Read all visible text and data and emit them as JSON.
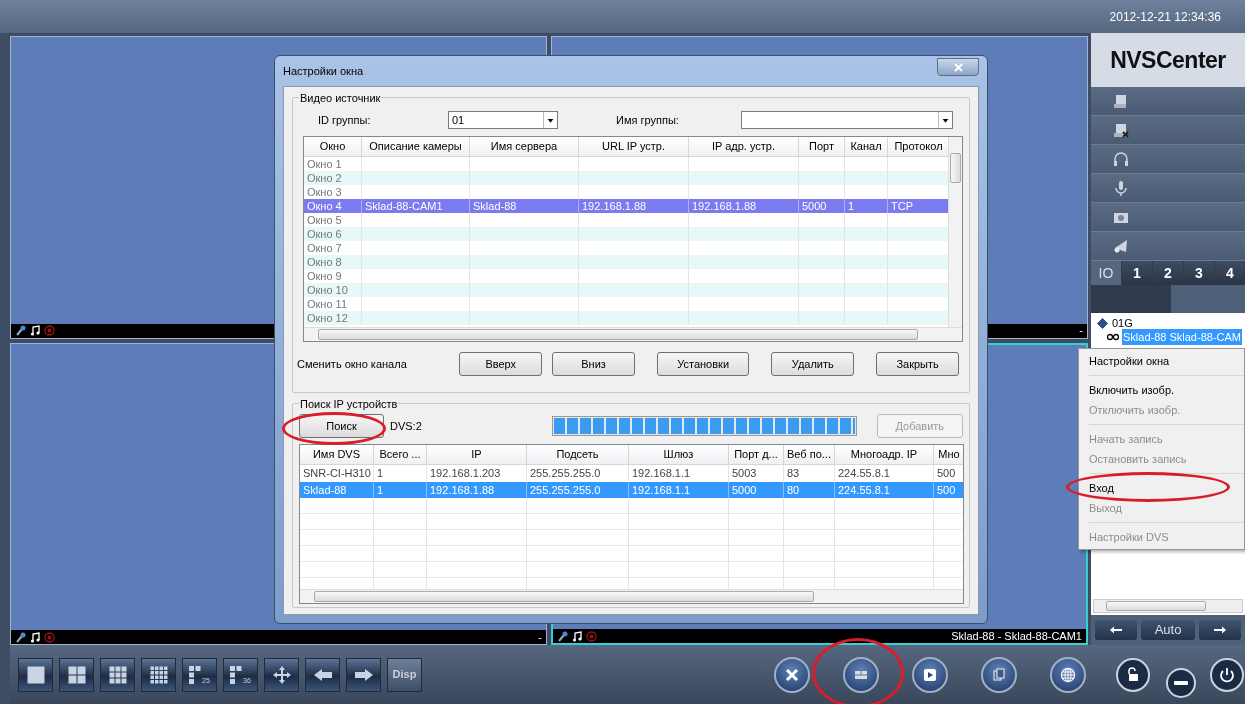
{
  "clock": "2012-12-21 12:34:36",
  "video_panes": [
    {
      "selected": false,
      "status_icons": true
    },
    {
      "selected": false,
      "dash": "-"
    },
    {
      "selected": false,
      "status_icons": true,
      "dash": "-"
    },
    {
      "selected": true,
      "status_icons": true,
      "caption": "Sklad-88 - Sklad-88-CAM1"
    }
  ],
  "dialog": {
    "title": "Настройки окна",
    "video_source": {
      "legend": "Видео источник",
      "group_id_label": "ID группы:",
      "group_id_value": "01",
      "group_name_label": "Имя группы:",
      "columns": [
        "Окно",
        "Описание камеры",
        "Имя сервера",
        "URL IP устр.",
        "IP адр. устр.",
        "Порт",
        "Канал",
        "Протокол"
      ],
      "rows": [
        {
          "cells": [
            "Окно 1"
          ],
          "selected": false
        },
        {
          "cells": [
            "Окно 2"
          ],
          "selected": false
        },
        {
          "cells": [
            "Окно 3"
          ],
          "selected": false
        },
        {
          "cells": [
            "Окно 4",
            "Sklad-88-CAM1",
            "Sklad-88",
            "192.168.1.88",
            "192.168.1.88",
            "5000",
            "1",
            "TCP"
          ],
          "selected": true
        },
        {
          "cells": [
            "Окно 5"
          ],
          "selected": false
        },
        {
          "cells": [
            "Окно 6"
          ],
          "selected": false
        },
        {
          "cells": [
            "Окно 7"
          ],
          "selected": false
        },
        {
          "cells": [
            "Окно 8"
          ],
          "selected": false
        },
        {
          "cells": [
            "Окно 9"
          ],
          "selected": false
        },
        {
          "cells": [
            "Окно 10"
          ],
          "selected": false
        },
        {
          "cells": [
            "Окно 11"
          ],
          "selected": false
        },
        {
          "cells": [
            "Окно 12"
          ],
          "selected": false
        }
      ],
      "change_label": "Сменить окно канала",
      "buttons": [
        "Вверх",
        "Вниз",
        "Установки",
        "Удалить",
        "Закрыть"
      ]
    },
    "ip_search": {
      "legend": "Поиск IP устройств",
      "search_button": "Поиск",
      "count": "DVS:2",
      "progress": {
        "level": 1
      },
      "add_button": {
        "label": "Добавить",
        "disabled": true
      },
      "columns": [
        "Имя DVS",
        "Всего ...",
        "IP",
        "Подсеть",
        "Шлюз",
        "Порт д...",
        "Веб по...",
        "Многоадр. IP",
        "Мно"
      ],
      "rows": [
        {
          "cells": [
            "SNR-CI-H310",
            "1",
            "192.168.1.203",
            "255.255.255.0",
            "192.168.1.1",
            "5003",
            "83",
            "224.55.8.1",
            "500"
          ],
          "selected": false
        },
        {
          "cells": [
            "Sklad-88",
            "1",
            "192.168.1.88",
            "255.255.255.0",
            "192.168.1.1",
            "5000",
            "80",
            "224.55.8.1",
            "500"
          ],
          "selected": true
        }
      ]
    }
  },
  "sidebar": {
    "logo": "NVSCenter",
    "tabs": [
      {
        "label": "IO",
        "selected": true
      },
      {
        "label": "1",
        "selected": false
      },
      {
        "label": "2",
        "selected": false
      },
      {
        "label": "3",
        "selected": false
      },
      {
        "label": "4",
        "selected": false
      }
    ],
    "tree": [
      {
        "label": "01G",
        "expanded": true,
        "children": [
          {
            "label": "Sklad-88 Sklad-88-CAM",
            "selected": true
          }
        ]
      }
    ],
    "nav_buttons": [
      {
        "kind": "prev"
      },
      {
        "kind": "text",
        "label": "Auto"
      },
      {
        "kind": "next"
      }
    ]
  },
  "context_menu": {
    "items": [
      {
        "kind": "item",
        "label": "Настройки окна",
        "disabled": false
      },
      {
        "kind": "separator"
      },
      {
        "kind": "item",
        "label": "Включить изобр.",
        "disabled": false
      },
      {
        "kind": "item",
        "label": "Отключить изобр.",
        "disabled": true
      },
      {
        "kind": "separator"
      },
      {
        "kind": "item",
        "label": "Начать запись",
        "disabled": true
      },
      {
        "kind": "item",
        "label": "Остановить запись",
        "disabled": true
      },
      {
        "kind": "separator"
      },
      {
        "kind": "item",
        "label": "Вход",
        "disabled": false
      },
      {
        "kind": "item",
        "label": "Выход",
        "disabled": true
      },
      {
        "kind": "separator"
      },
      {
        "kind": "item",
        "label": "Настройки DVS",
        "disabled": true
      }
    ]
  },
  "toolbar": {
    "layout_buttons": [
      {
        "kind": "single"
      },
      {
        "kind": "quad"
      },
      {
        "kind": "nine"
      },
      {
        "kind": "sixteen"
      },
      {
        "kind": "custom",
        "label": "25"
      },
      {
        "kind": "custom",
        "label": "36"
      },
      {
        "kind": "move"
      },
      {
        "kind": "left"
      },
      {
        "kind": "right"
      },
      {
        "kind": "text",
        "label": "Disp"
      }
    ]
  }
}
